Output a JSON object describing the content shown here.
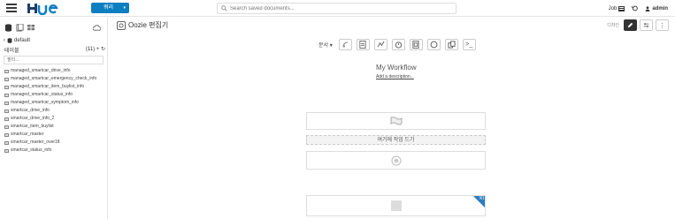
{
  "header": {
    "logo": "HUE",
    "query_button": "쿼리",
    "search_placeholder": "Search saved documents...",
    "job_label": "Job",
    "user": "admin"
  },
  "sidebar": {
    "database": "default",
    "tables_label": "테이블",
    "tables_count": "(11)",
    "filter_placeholder": "필터...",
    "tables": [
      "managed_smartcar_drive_info",
      "managed_smartcar_emergency_check_info",
      "managed_smartcar_item_buylist_info",
      "managed_smartcar_status_info",
      "managed_smartcar_symptom_info",
      "smartcar_drive_info",
      "smartcar_drive_info_2",
      "smartcar_item_buylist",
      "smartcar_master",
      "smartcar_master_over18",
      "smartcar_status_info"
    ]
  },
  "editor": {
    "title": "Oozie 편집기",
    "right_label": "디자인",
    "documents_label": "문서",
    "workflow_name": "My Workflow",
    "add_description": "Add a description...",
    "drop_label": "여기에 작업 드기",
    "kill_corner": "KI"
  },
  "colors": {
    "accent": "#0b7fc1",
    "dark_button": "#333333",
    "kill_corner": "#2d7cc1"
  }
}
